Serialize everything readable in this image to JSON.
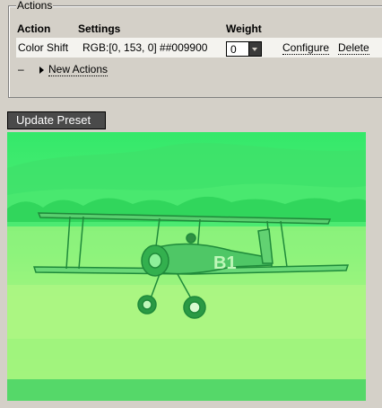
{
  "actions": {
    "legend": "Actions",
    "headers": {
      "action": "Action",
      "settings": "Settings",
      "weight": "Weight"
    },
    "row": {
      "action": "Color Shift",
      "settings": "RGB:[0, 153, 0] ##009900",
      "weight": "0",
      "configure_label": "Configure",
      "delete_label": "Delete"
    },
    "new_actions_label": "New Actions",
    "dash": "–"
  },
  "update_button_label": "Update Preset",
  "photo": {
    "tint_color": "#00ff33",
    "roundel_text": "B1"
  },
  "colors": {
    "background": "#d4d0c8",
    "button_bg": "#4a4a4a",
    "photo_tint": "#5af06e"
  }
}
